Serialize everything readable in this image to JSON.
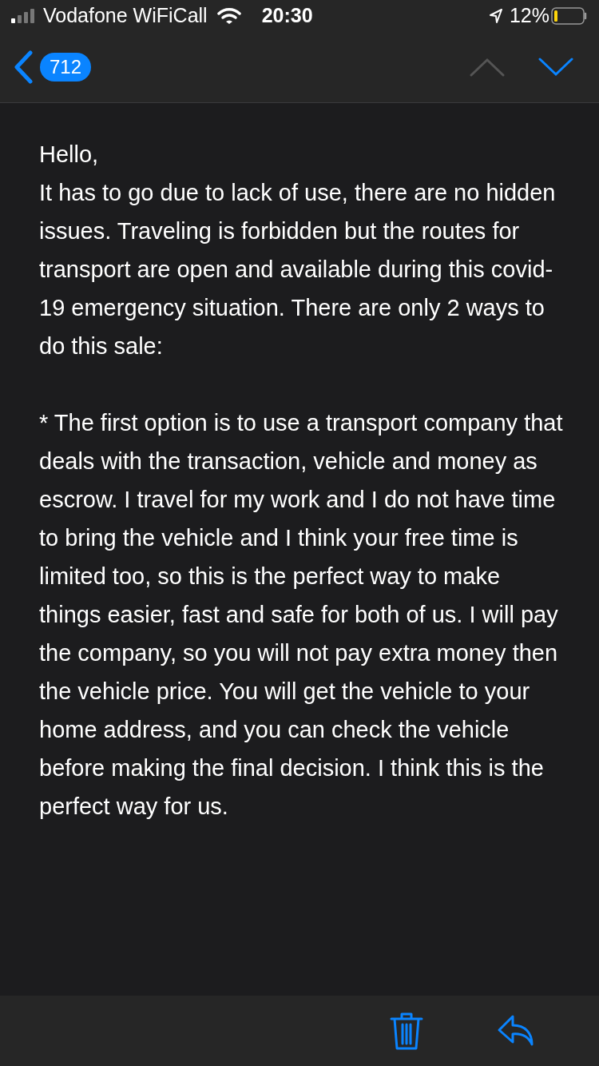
{
  "status_bar": {
    "carrier": "Vodafone WiFiCall",
    "time": "20:30",
    "battery": "12%"
  },
  "nav_bar": {
    "back_count": "712",
    "previous_disabled": true,
    "next_disabled": false
  },
  "message": {
    "paragraphs": [
      "Hello,\nIt has to go due to lack of use, there are no hidden issues. Traveling is forbidden but the routes for transport are open and available during this covid-19 emergency situation. There are only 2 ways to do this sale:",
      "* The first option is to use a transport company that deals with the transaction, vehicle and money as escrow. I travel for my work and I do not have time to bring the vehicle and I think your free time is limited too, so this is the perfect way to make things easier, fast and safe for both of us. I will pay the company, so you will not pay extra money then the vehicle price. You will get the vehicle to your home address, and you can check the vehicle before making the final decision. I think this is the perfect way for us."
    ]
  }
}
